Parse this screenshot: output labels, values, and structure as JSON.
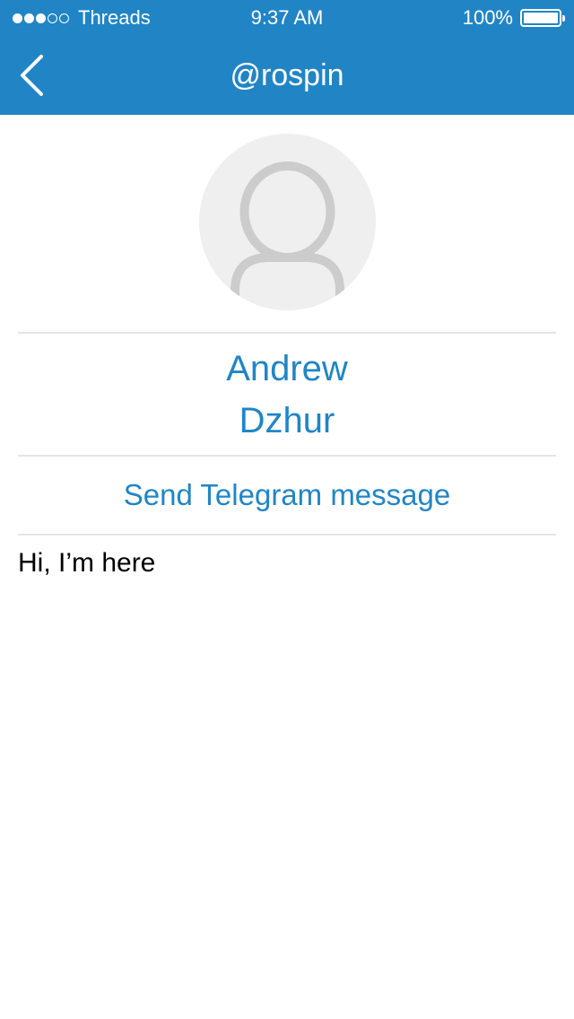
{
  "status_bar": {
    "carrier": "Threads",
    "time": "9:37 AM",
    "battery": "100%",
    "signal_bars_filled": 3,
    "signal_bars_total": 5,
    "battery_level": 1.0
  },
  "nav": {
    "title": "@rospin",
    "back_icon": "chevron-left-icon"
  },
  "profile": {
    "first_name": "Andrew",
    "last_name": "Dzhur",
    "avatar_icon": "person-placeholder-icon",
    "send_label": "Send Telegram message",
    "bio": "Hi, I’m here"
  },
  "colors": {
    "accent": "#2185c5",
    "avatar_bg": "#efefef",
    "avatar_fg": "#cccccc",
    "divider": "#e5e5e5"
  }
}
